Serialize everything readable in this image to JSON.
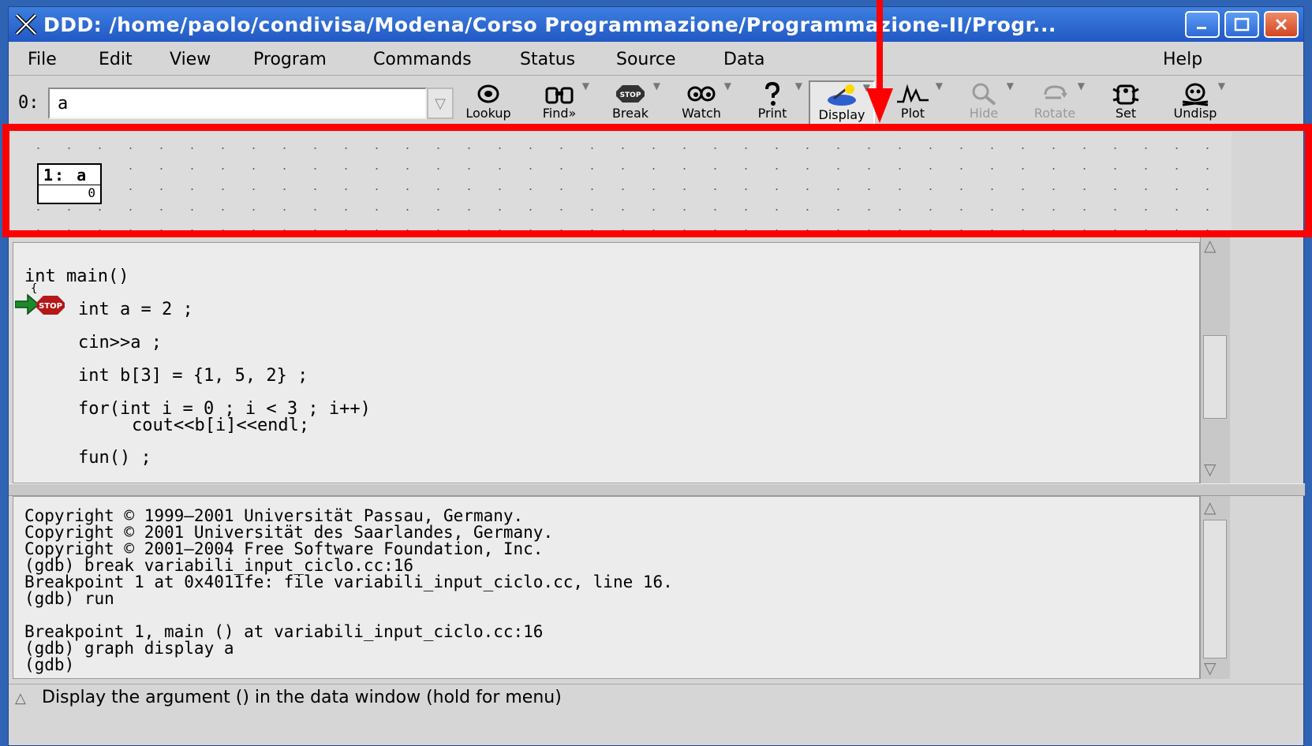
{
  "window": {
    "title": "DDD: /home/paolo/condivisa/Modena/Corso Programmazione/Programmazione-II/Progr..."
  },
  "menu": {
    "file": "File",
    "edit": "Edit",
    "view": "View",
    "program": "Program",
    "commands": "Commands",
    "status": "Status",
    "source": "Source",
    "data": "Data",
    "help": "Help"
  },
  "toolbar": {
    "arg_label": "0:",
    "arg_value": "a",
    "lookup": "Lookup",
    "find": "Find»",
    "break": "Break",
    "watch": "Watch",
    "print": "Print",
    "display": "Display",
    "plot": "Plot",
    "hide": "Hide",
    "rotate": "Rotate",
    "set": "Set",
    "undisp": "Undisp"
  },
  "data_window": {
    "node_title": "1: a",
    "node_value": "0"
  },
  "source": {
    "lines": [
      "int main()",
      "{",
      "int a = 2 ;",
      "cin>>a ;",
      "int b[3] = {1, 5, 2} ;",
      "for(int i = 0 ; i < 3 ; i++)",
      "cout<<b[i]<<endl;",
      "fun() ;"
    ],
    "stop_label": "STOP"
  },
  "console": {
    "lines": [
      "Copyright © 1999–2001 Universität Passau, Germany.",
      "Copyright © 2001 Universität des Saarlandes, Germany.",
      "Copyright © 2001–2004 Free Software Foundation, Inc.",
      "(gdb) break variabili_input_ciclo.cc:16",
      "Breakpoint 1 at 0x4011fe: file variabili_input_ciclo.cc, line 16.",
      "(gdb) run",
      "",
      "Breakpoint 1, main () at variabili_input_ciclo.cc:16",
      "(gdb) graph display a",
      "(gdb)"
    ]
  },
  "status_bar": {
    "text": "Display the argument () in the data window (hold for menu)"
  },
  "colors": {
    "highlight_frame": "#ff0000",
    "titlebar": "#2f6ad6"
  }
}
